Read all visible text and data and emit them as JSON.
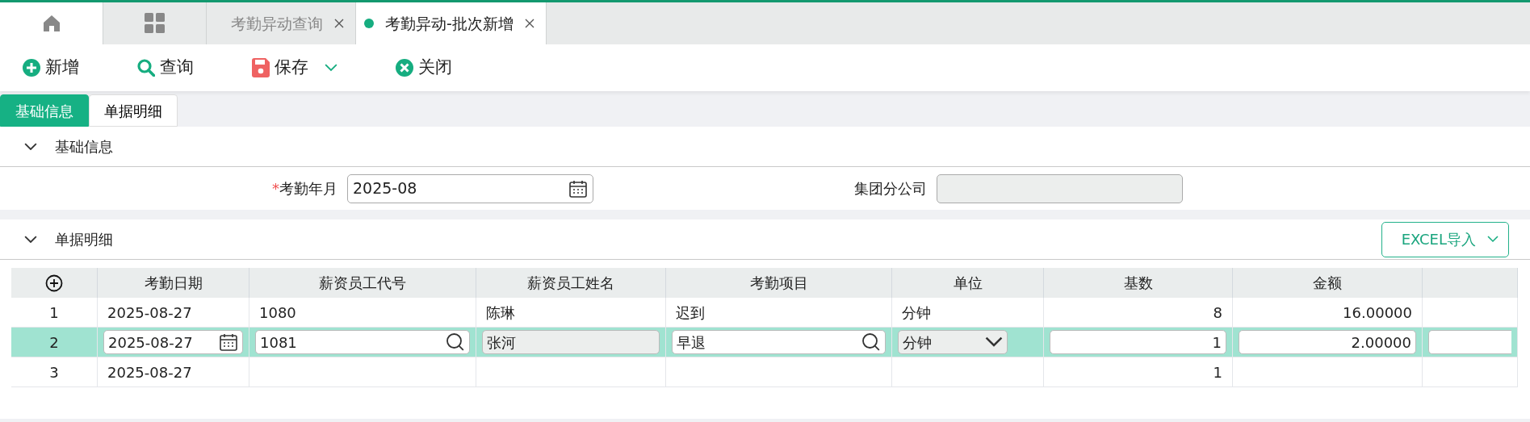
{
  "tabs": [
    {
      "kind": "home",
      "selected": true
    },
    {
      "kind": "apps",
      "selected": false
    },
    {
      "kind": "page",
      "label": "考勤异动查询",
      "selected": false
    },
    {
      "kind": "page",
      "label": "考勤异动-批次新增",
      "selected": true
    }
  ],
  "toolbar": [
    {
      "kind": "add",
      "label": "新增",
      "dropdown": false
    },
    {
      "kind": "search",
      "label": "查询",
      "dropdown": false
    },
    {
      "kind": "save",
      "label": "保存",
      "dropdown": true
    },
    {
      "kind": "close",
      "label": "关闭",
      "dropdown": false
    }
  ],
  "form_tabs": [
    {
      "label": "基础信息",
      "selected": true
    },
    {
      "label": "单据明细",
      "selected": false
    }
  ],
  "basic_section": {
    "title": "基础信息",
    "expanded": true,
    "fields": [
      {
        "required_mark": "*",
        "label": "考勤年月",
        "kind": "date",
        "value": "2025-08",
        "disabled": false
      },
      {
        "label": "集团分公司",
        "kind": "text",
        "disabled": true
      }
    ]
  },
  "detail_section": {
    "title": "单据明细",
    "expanded": true,
    "import_button": "EXCEL导入"
  },
  "table": {
    "columns": [
      {
        "label": "考勤日期",
        "kind": "date"
      },
      {
        "label": "薪资员工代号",
        "kind": "lookup"
      },
      {
        "label": "薪资员工姓名",
        "kind": "readonly"
      },
      {
        "label": "考勤项目",
        "kind": "lookup"
      },
      {
        "label": "单位",
        "kind": "select"
      },
      {
        "label": "基数",
        "kind": "number"
      },
      {
        "label": "金额",
        "kind": "number"
      },
      {
        "kind": "text"
      }
    ],
    "rows": [
      {
        "index": "1",
        "selected": false,
        "cells": [
          "2025-08-27",
          "1080",
          "陈琳",
          "迟到",
          "分钟",
          "8",
          "16.00000",
          null
        ]
      },
      {
        "index": "2",
        "selected": true,
        "cells": [
          "2025-08-27",
          "1081",
          "张河",
          "早退",
          "分钟",
          "1",
          "2.00000",
          null
        ]
      },
      {
        "index": "3",
        "selected": false,
        "cells": [
          "2025-08-27",
          null,
          null,
          null,
          null,
          "1",
          null,
          null
        ]
      }
    ]
  }
}
